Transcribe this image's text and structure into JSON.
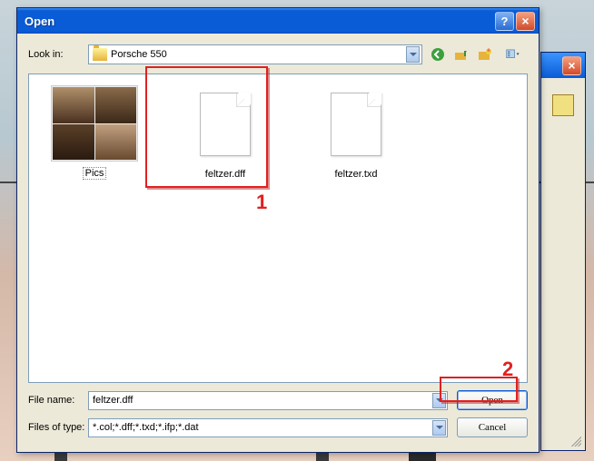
{
  "dialog": {
    "title": "Open",
    "lookin_label": "Look in:",
    "folder_name": "Porsche 550",
    "filename_label": "File name:",
    "filename_value": "feltzer.dff",
    "filetype_label": "Files of type:",
    "filetype_value": "*.col;*.dff;*.txd;*.ifp;*.dat",
    "open_btn": "Open",
    "cancel_btn": "Cancel"
  },
  "files": [
    {
      "name": "Pics",
      "kind": "folder-preview"
    },
    {
      "name": "feltzer.dff",
      "kind": "file"
    },
    {
      "name": "feltzer.txd",
      "kind": "file"
    }
  ],
  "annotations": {
    "a1": "1",
    "a2": "2"
  }
}
